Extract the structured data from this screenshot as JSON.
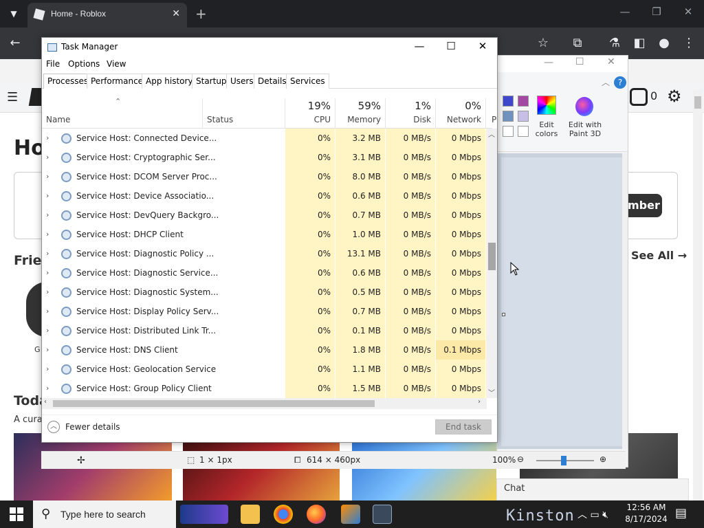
{
  "browser": {
    "tab_title": "Home - Roblox",
    "tab_close": "✕",
    "new_tab": "+",
    "window_controls": {
      "minimize": "—",
      "restore": "❐",
      "close": "✕"
    }
  },
  "roblox": {
    "home_heading_partial": "Ho",
    "robux_count": "0",
    "join_button_partial": "mber",
    "friends_heading_partial": "Frie",
    "see_all": "See All →",
    "friend_name_partial": "G",
    "today_heading_partial": "Toda",
    "today_sub_partial": "A cura",
    "chat_label": "Chat"
  },
  "paint": {
    "edit_colors": "Edit colors",
    "edit_with_paint3d": "Edit with Paint 3D",
    "status_selection": "1 × 1px",
    "status_size": "614 × 460px",
    "zoom": "100%"
  },
  "taskmgr": {
    "title": "Task Manager",
    "window_controls": {
      "minimize": "—",
      "maximize": "☐",
      "close": "✕"
    },
    "menu": [
      "File",
      "Options",
      "View"
    ],
    "tabs": [
      "Processes",
      "Performance",
      "App history",
      "Startup",
      "Users",
      "Details",
      "Services"
    ],
    "active_tab": "Processes",
    "columns": {
      "name": "Name",
      "status": "Status",
      "cpu_pct": "19%",
      "cpu": "CPU",
      "mem_pct": "59%",
      "mem": "Memory",
      "disk_pct": "1%",
      "disk": "Disk",
      "net_pct": "0%",
      "net": "Network",
      "power_partial": "P"
    },
    "rows": [
      {
        "name": "Service Host: Connected Device...",
        "cpu": "0%",
        "mem": "3.2 MB",
        "disk": "0 MB/s",
        "net": "0 Mbps"
      },
      {
        "name": "Service Host: Cryptographic Ser...",
        "cpu": "0%",
        "mem": "3.1 MB",
        "disk": "0 MB/s",
        "net": "0 Mbps"
      },
      {
        "name": "Service Host: DCOM Server Proc...",
        "cpu": "0%",
        "mem": "8.0 MB",
        "disk": "0 MB/s",
        "net": "0 Mbps"
      },
      {
        "name": "Service Host: Device Associatio...",
        "cpu": "0%",
        "mem": "0.6 MB",
        "disk": "0 MB/s",
        "net": "0 Mbps"
      },
      {
        "name": "Service Host: DevQuery Backgro...",
        "cpu": "0%",
        "mem": "0.7 MB",
        "disk": "0 MB/s",
        "net": "0 Mbps"
      },
      {
        "name": "Service Host: DHCP Client",
        "cpu": "0%",
        "mem": "1.0 MB",
        "disk": "0 MB/s",
        "net": "0 Mbps"
      },
      {
        "name": "Service Host: Diagnostic Policy ...",
        "cpu": "0%",
        "mem": "13.1 MB",
        "disk": "0 MB/s",
        "net": "0 Mbps"
      },
      {
        "name": "Service Host: Diagnostic Service...",
        "cpu": "0%",
        "mem": "0.6 MB",
        "disk": "0 MB/s",
        "net": "0 Mbps"
      },
      {
        "name": "Service Host: Diagnostic System...",
        "cpu": "0%",
        "mem": "0.5 MB",
        "disk": "0 MB/s",
        "net": "0 Mbps"
      },
      {
        "name": "Service Host: Display Policy Serv...",
        "cpu": "0%",
        "mem": "0.7 MB",
        "disk": "0 MB/s",
        "net": "0 Mbps"
      },
      {
        "name": "Service Host: Distributed Link Tr...",
        "cpu": "0%",
        "mem": "0.1 MB",
        "disk": "0 MB/s",
        "net": "0 Mbps"
      },
      {
        "name": "Service Host: DNS Client",
        "cpu": "0%",
        "mem": "1.8 MB",
        "disk": "0 MB/s",
        "net": "0.1 Mbps"
      },
      {
        "name": "Service Host: Geolocation Service",
        "cpu": "0%",
        "mem": "1.1 MB",
        "disk": "0 MB/s",
        "net": "0 Mbps"
      },
      {
        "name": "Service Host: Group Policy Client",
        "cpu": "0%",
        "mem": "1.5 MB",
        "disk": "0 MB/s",
        "net": "0 Mbps"
      }
    ],
    "fewer_details": "Fewer details",
    "end_task": "End task"
  },
  "taskbar": {
    "search_placeholder": "Type here to search",
    "time": "12:56 AM",
    "date": "8/17/2024",
    "weather_text": "Kinston"
  },
  "colors": {
    "usage_cell": "#fff4c4",
    "usage_cell_highlight": "#fce9a7",
    "taskbar": "#1f1f1f",
    "browser_dark": "#202124"
  }
}
